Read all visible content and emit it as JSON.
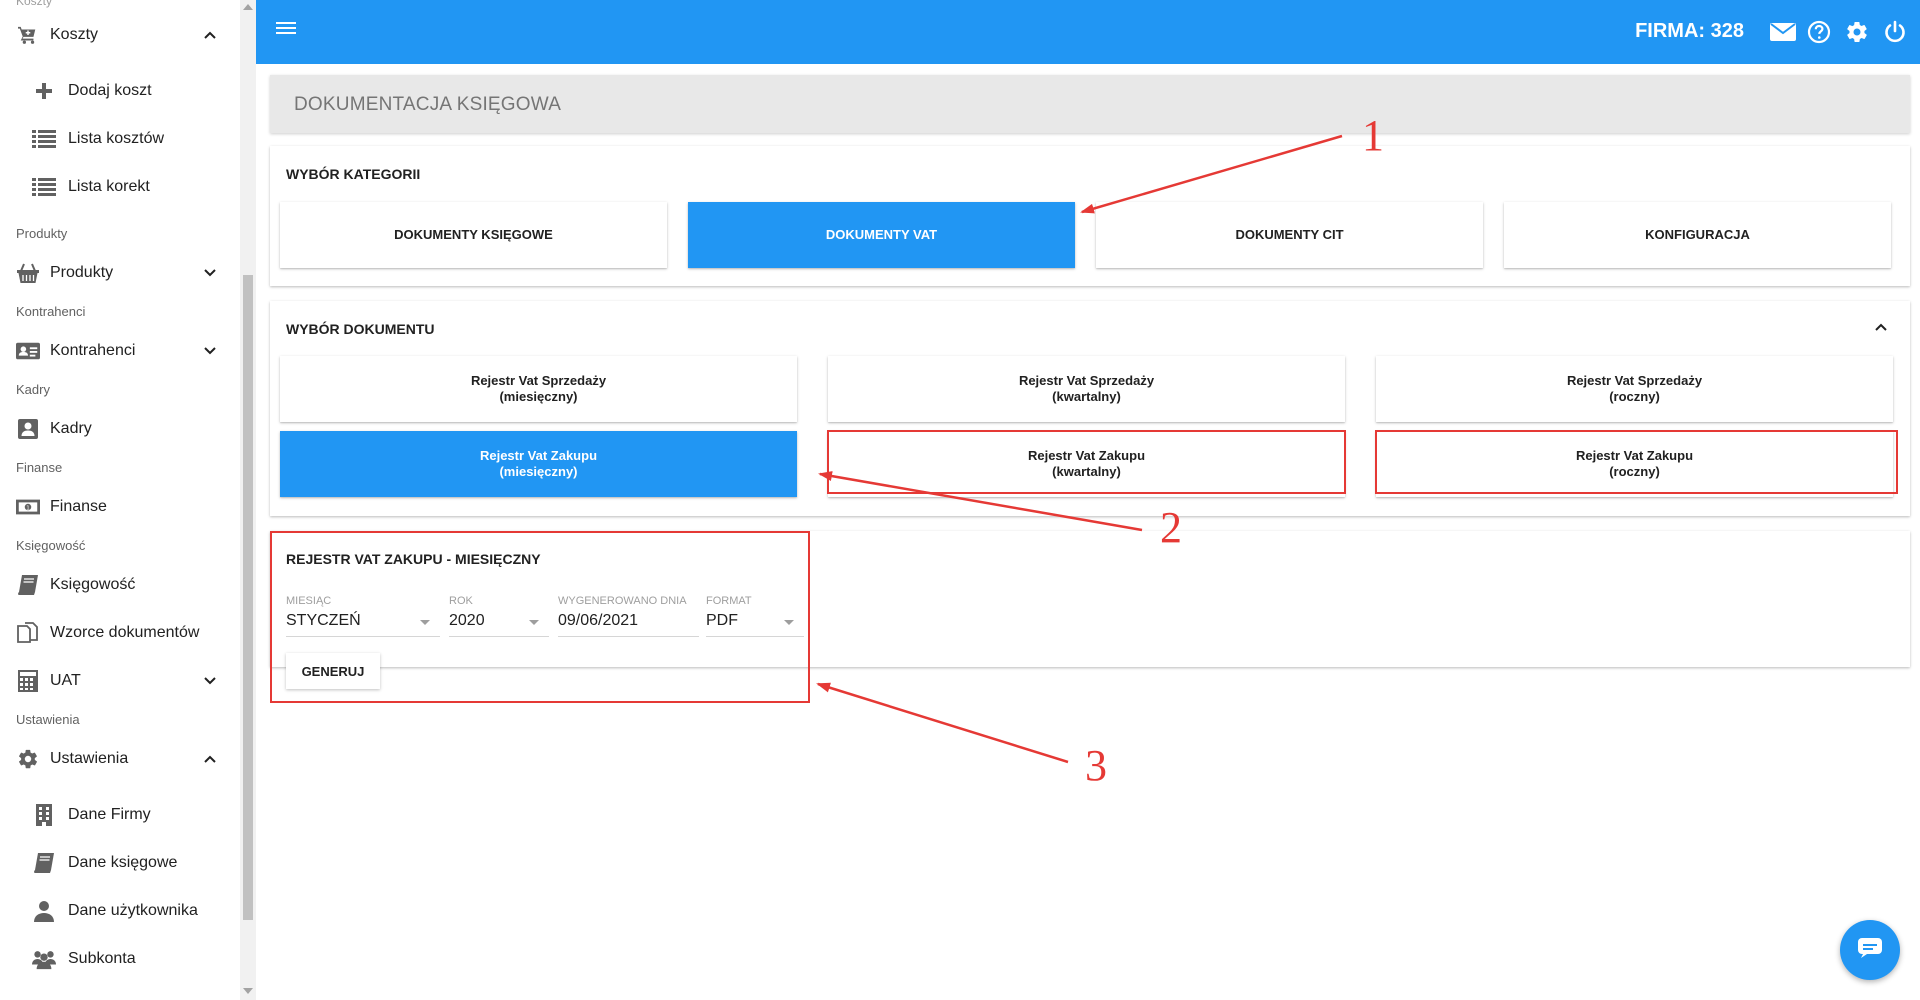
{
  "sidebar": {
    "top_cut_label": "Koszty",
    "sections": {
      "koszty": "Koszty",
      "dodaj_koszt": "Dodaj koszt",
      "lista_kosztow": "Lista kosztów",
      "lista_korekt": "Lista korekt",
      "produkty_header": "Produkty",
      "produkty": "Produkty",
      "kontrahenci_header": "Kontrahenci",
      "kontrahenci": "Kontrahenci",
      "kadry_header": "Kadry",
      "kadry": "Kadry",
      "finanse_header": "Finanse",
      "finanse": "Finanse",
      "ksiegowosc_header": "Księgowość",
      "ksiegowosc": "Księgowość",
      "wzorce": "Wzorce dokumentów",
      "uat": "UAT",
      "ustawienia_header": "Ustawienia",
      "ustawienia": "Ustawienia",
      "dane_firmy": "Dane Firmy",
      "dane_ksiegowe": "Dane księgowe",
      "dane_uzytkownika": "Dane użytkownika",
      "subkonta": "Subkonta"
    }
  },
  "topbar": {
    "firma_label": "FIRMA: 328",
    "icons": [
      "mail-icon",
      "help-icon",
      "gear-icon",
      "power-icon"
    ],
    "color": "#2196f3"
  },
  "page": {
    "title": "DOKUMENTACJA KSIĘGOWA"
  },
  "category_card": {
    "title": "WYBÓR KATEGORII",
    "buttons": {
      "ksiegowe": "DOKUMENTY KSIĘGOWE",
      "vat": "DOKUMENTY VAT",
      "cit": "DOKUMENTY CIT",
      "konfiguracja": "KONFIGURACJA"
    },
    "active": "vat"
  },
  "document_card": {
    "title": "WYBÓR DOKUMENTU",
    "buttons": {
      "sprz_mies_line1": "Rejestr Vat Sprzedaży",
      "sprz_mies_line2": "(miesięczny)",
      "sprz_kw_line1": "Rejestr Vat Sprzedaży",
      "sprz_kw_line2": "(kwartalny)",
      "sprz_rocz_line1": "Rejestr Vat Sprzedaży",
      "sprz_rocz_line2": "(roczny)",
      "zak_mies_line1": "Rejestr Vat Zakupu",
      "zak_mies_line2": "(miesięczny)",
      "zak_kw_line1": "Rejestr Vat Zakupu",
      "zak_kw_line2": "(kwartalny)",
      "zak_rocz_line1": "Rejestr Vat Zakupu",
      "zak_rocz_line2": "(roczny)"
    },
    "active": "zak_mies"
  },
  "report_card": {
    "title": "REJESTR VAT ZAKUPU - MIESIĘCZNY",
    "fields": {
      "miesiac_label": "MIESIĄC",
      "miesiac_value": "STYCZEŃ",
      "rok_label": "ROK",
      "rok_value": "2020",
      "wygenerowano_label": "WYGENEROWANO DNIA",
      "wygenerowano_value": "09/06/2021",
      "format_label": "FORMAT",
      "format_value": "PDF"
    },
    "generate_label": "GENERUJ"
  },
  "annotations": {
    "n1": "1",
    "n2": "2",
    "n3": "3",
    "color": "#e53935"
  }
}
